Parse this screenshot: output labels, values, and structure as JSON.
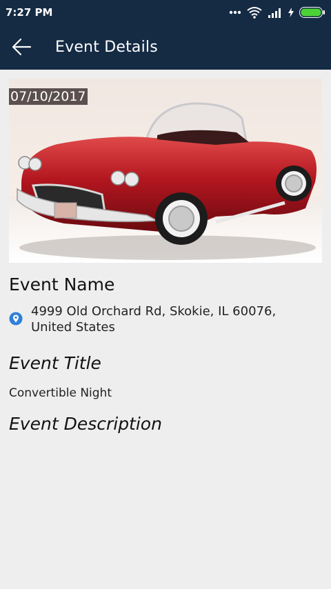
{
  "status_bar": {
    "time": "7:27 PM",
    "icons": [
      "dots-icon",
      "wifi-icon",
      "signal-icon",
      "charging-icon",
      "battery-icon"
    ]
  },
  "app_bar": {
    "title": "Event Details",
    "back_icon": "back-arrow-icon"
  },
  "event": {
    "date": "07/10/2017",
    "name": "Event Name",
    "address": "4999 Old Orchard Rd, Skokie, IL 60076, United States",
    "title_heading": "Event Title",
    "title_value": "Convertible Night",
    "description_heading": "Event Description",
    "description_value": ""
  },
  "colors": {
    "app_bar": "#152b44",
    "background": "#eeeeee",
    "pin": "#2f80d8",
    "battery": "#4cd137"
  }
}
